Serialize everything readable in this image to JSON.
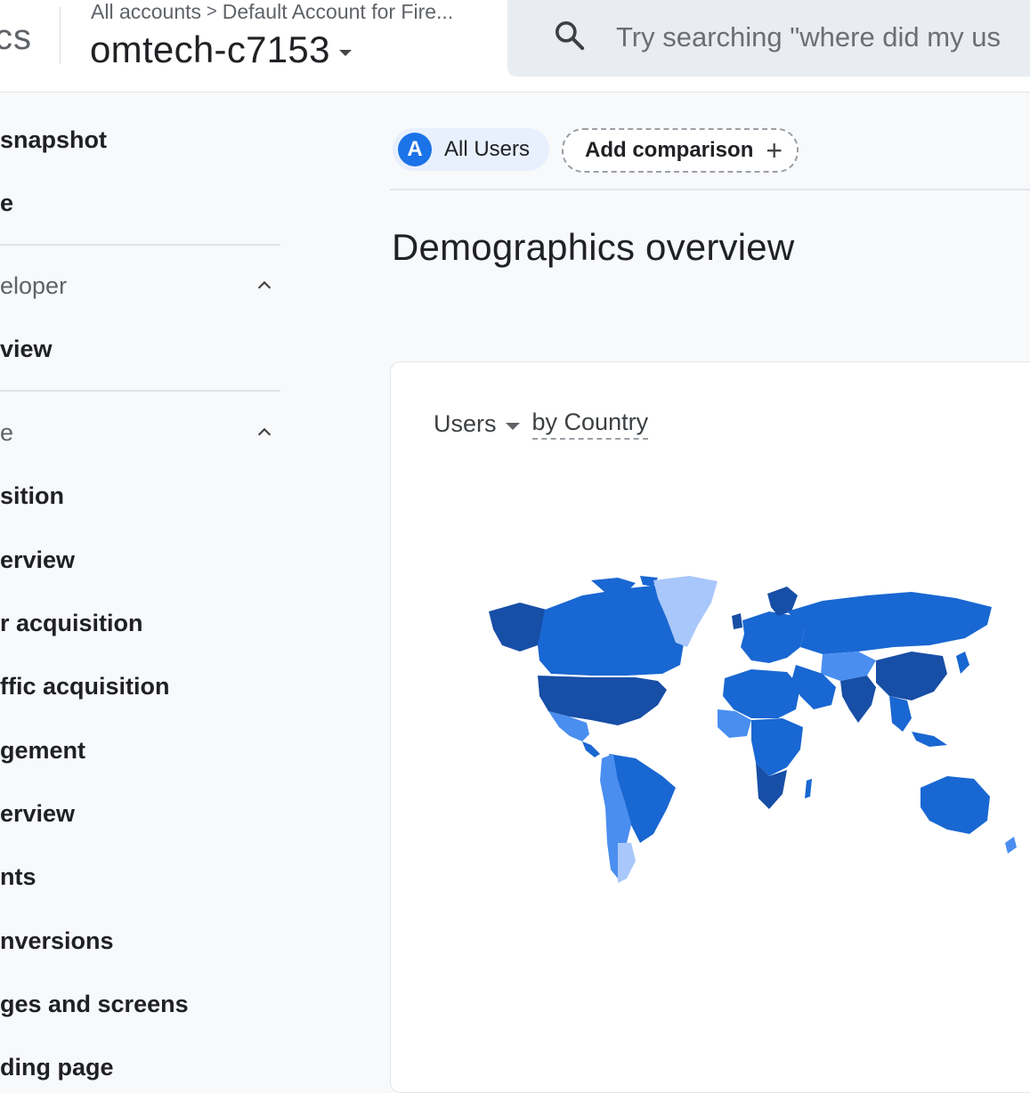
{
  "header": {
    "app_name_partial": "cs",
    "breadcrumb": {
      "accounts": "All accounts",
      "separator": ">",
      "account": "Default Account for Fire..."
    },
    "property": "omtech-c7153",
    "search": {
      "placeholder": "Try searching \"where did my us"
    }
  },
  "sidebar": {
    "items": [
      {
        "label": "snapshot"
      },
      {
        "label": "e"
      },
      {
        "label": "eloper"
      },
      {
        "label": "view"
      },
      {
        "label": "e"
      },
      {
        "label": "sition"
      },
      {
        "label": "erview"
      },
      {
        "label": "r acquisition"
      },
      {
        "label": "ffic acquisition"
      },
      {
        "label": "gement"
      },
      {
        "label": "erview"
      },
      {
        "label": "nts"
      },
      {
        "label": "nversions"
      },
      {
        "label": "ges and screens"
      },
      {
        "label": "ding page"
      }
    ]
  },
  "main": {
    "comparison": {
      "avatar_letter": "A",
      "all_users": "All Users",
      "add_comparison": "Add comparison"
    },
    "title": "Demographics overview",
    "card": {
      "metric": "Users",
      "dimension": "by Country"
    }
  },
  "colors": {
    "accent": "#1a73e8",
    "map_dark": "#174ea6",
    "map_mid": "#1967d2",
    "map_light": "#4a8ef0",
    "map_pale": "#a8c7fa"
  },
  "icons": {
    "search": "search-icon",
    "dropdown": "chevron-down-icon",
    "collapse": "chevron-up-icon",
    "add": "plus-icon"
  }
}
